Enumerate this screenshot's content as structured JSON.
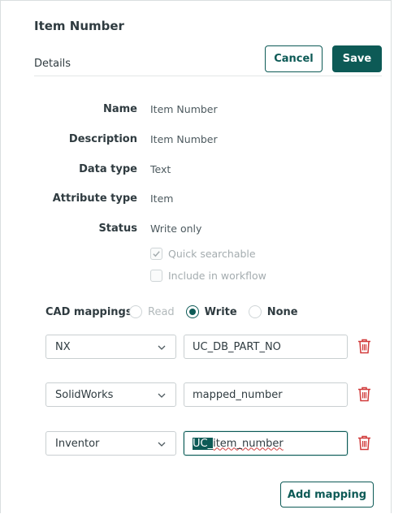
{
  "header": {
    "title": "Item Number",
    "section": "Details"
  },
  "actions": {
    "cancel_label": "Cancel",
    "save_label": "Save"
  },
  "fields": [
    {
      "label": "Name",
      "value": "Item Number"
    },
    {
      "label": "Description",
      "value": "Item Number"
    },
    {
      "label": "Data type",
      "value": "Text"
    },
    {
      "label": "Attribute type",
      "value": "Item"
    },
    {
      "label": "Status",
      "value": "Write only"
    }
  ],
  "options": {
    "quick_searchable": {
      "label": "Quick searchable",
      "checked": true,
      "disabled": true
    },
    "include_in_workflow": {
      "label": "Include in workflow",
      "checked": false,
      "disabled": true
    }
  },
  "cad": {
    "label": "CAD mappings",
    "radios": [
      {
        "label": "Read",
        "checked": false,
        "disabled": true
      },
      {
        "label": "Write",
        "checked": true,
        "disabled": false
      },
      {
        "label": "None",
        "checked": false,
        "disabled": false
      }
    ],
    "mappings": [
      {
        "system": "NX",
        "value": "UC_DB_PART_NO",
        "icon": "trash-icon"
      },
      {
        "system": "SolidWorks",
        "value": "mapped_number",
        "icon": "trash-icon"
      },
      {
        "system": "Inventor",
        "value_selected": "UC_",
        "value_rest": "item_number",
        "icon": "trash-icon"
      }
    ],
    "add_label": "Add mapping"
  },
  "colors": {
    "accent": "#0d5a56",
    "danger": "#d13b3b"
  }
}
